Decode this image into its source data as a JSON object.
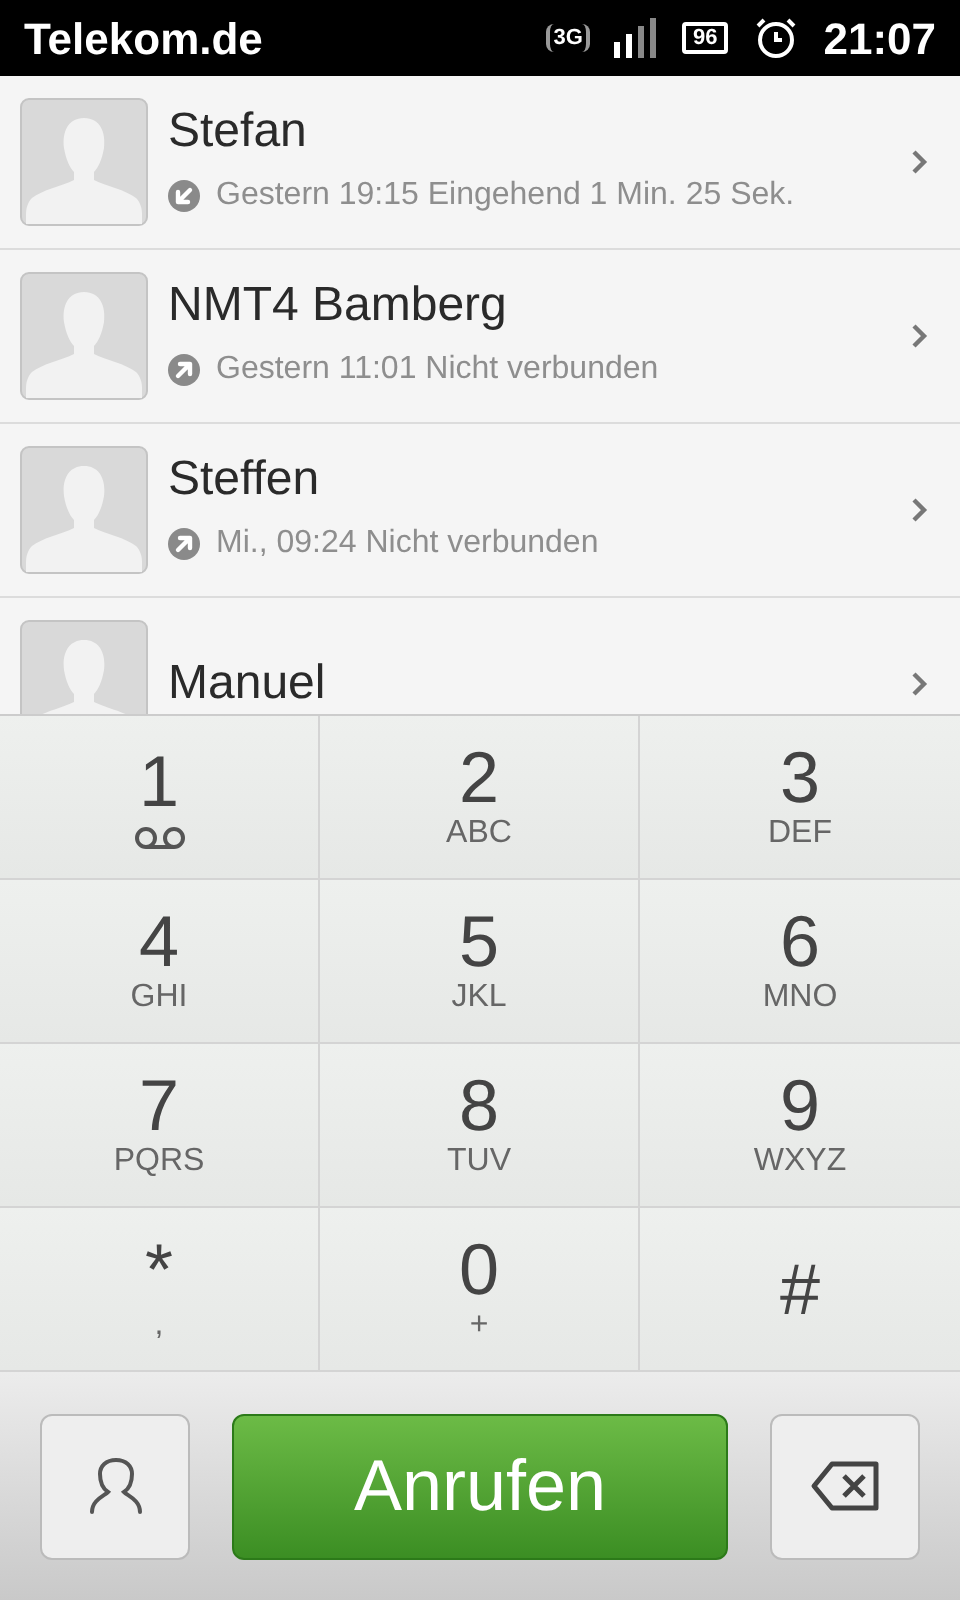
{
  "status_bar": {
    "carrier": "Telekom.de",
    "network": "3G",
    "battery": "96",
    "time": "21:07"
  },
  "calls": [
    {
      "name": "Stefan",
      "kind": "incoming",
      "detail": "Gestern 19:15 Eingehend 1 Min. 25 Sek."
    },
    {
      "name": "NMT4 Bamberg",
      "kind": "outgoing",
      "detail": "Gestern 11:01 Nicht verbunden"
    },
    {
      "name": "Steffen",
      "kind": "outgoing",
      "detail": "Mi., 09:24 Nicht verbunden"
    },
    {
      "name": "Manuel"
    }
  ],
  "keypad": [
    {
      "digit": "1",
      "kind": "voicemail"
    },
    {
      "digit": "2",
      "letters": "ABC"
    },
    {
      "digit": "3",
      "letters": "DEF"
    },
    {
      "digit": "4",
      "letters": "GHI"
    },
    {
      "digit": "5",
      "letters": "JKL"
    },
    {
      "digit": "6",
      "letters": "MNO"
    },
    {
      "digit": "7",
      "letters": "PQRS"
    },
    {
      "digit": "8",
      "letters": "TUV"
    },
    {
      "digit": "9",
      "letters": "WXYZ"
    },
    {
      "digit": "*",
      "letters": ","
    },
    {
      "digit": "0",
      "letters": "+"
    },
    {
      "digit": "#"
    }
  ],
  "call_button": "Anrufen"
}
